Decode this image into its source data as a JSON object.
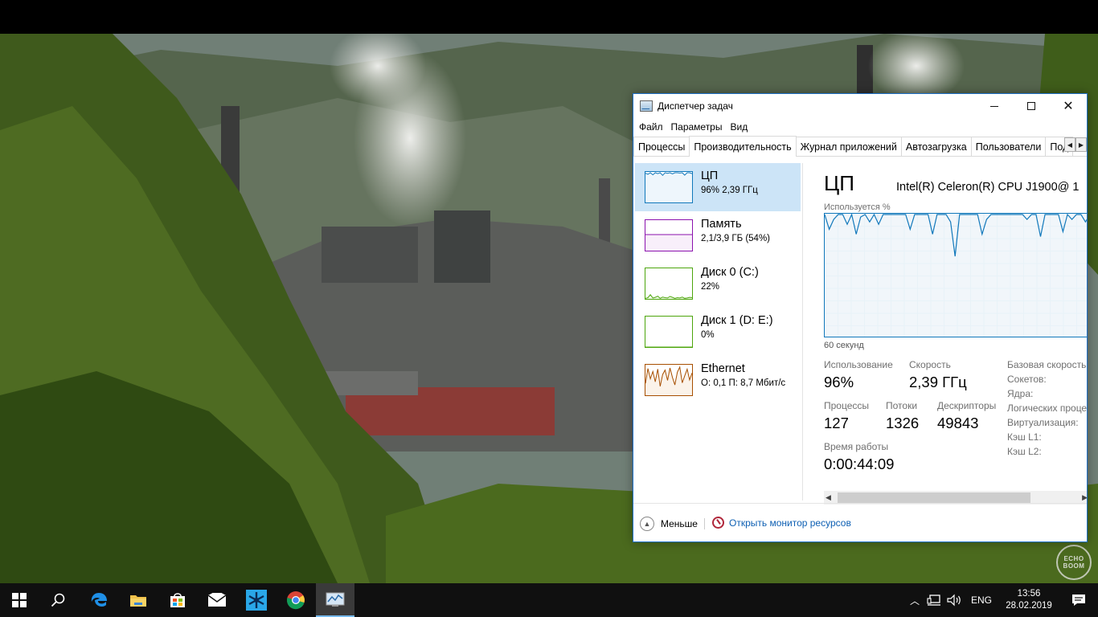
{
  "window": {
    "title": "Диспетчер задач",
    "menu": [
      "Файл",
      "Параметры",
      "Вид"
    ],
    "tabs": [
      "Процессы",
      "Производительность",
      "Журнал приложений",
      "Автозагрузка",
      "Пользователи",
      "Под"
    ],
    "active_tab": "Производительность"
  },
  "resources": [
    {
      "name": "ЦП",
      "detail": "96% 2,39 ГГц",
      "color": "#1178bb",
      "selected": true
    },
    {
      "name": "Память",
      "detail": "2,1/3,9 ГБ (54%)",
      "color": "#8b12ae",
      "selected": false
    },
    {
      "name": "Диск 0 (C:)",
      "detail": "22%",
      "color": "#4da60c",
      "selected": false
    },
    {
      "name": "Диск 1 (D: E:)",
      "detail": "0%",
      "color": "#4da60c",
      "selected": false
    },
    {
      "name": "Ethernet",
      "detail": "О: 0,1 П: 8,7 Мбит/с",
      "color": "#a74f01",
      "selected": false
    }
  ],
  "detail": {
    "title": "ЦП",
    "model": "Intel(R) Celeron(R) CPU J1900@ 1",
    "util_label": "Используется %",
    "time_label": "60 секунд",
    "stats": {
      "usage_label": "Использование",
      "usage_value": "96%",
      "speed_label": "Скорость",
      "speed_value": "2,39 ГГц",
      "processes_label": "Процессы",
      "processes_value": "127",
      "threads_label": "Потоки",
      "threads_value": "1326",
      "handles_label": "Дескрипторы",
      "handles_value": "49843",
      "uptime_label": "Время работы",
      "uptime_value": "0:00:44:09"
    },
    "kv": [
      "Базовая скорость:",
      "Сокетов:",
      "Ядра:",
      "Логических проце",
      "Виртуализация:",
      "Кэш L1:",
      "Кэш L2:"
    ]
  },
  "chart_data": {
    "type": "line",
    "title": "",
    "ylabel": "Используется %",
    "xlabel": "60 секунд",
    "ylim": [
      0,
      100
    ],
    "series": [
      {
        "values": [
          100,
          88,
          96,
          100,
          100,
          92,
          100,
          84,
          98,
          100,
          94,
          100,
          92,
          100,
          100,
          100,
          100,
          100,
          100,
          88,
          100,
          100,
          100,
          100,
          84,
          100,
          100,
          100,
          94,
          66,
          100,
          100,
          100,
          100,
          100,
          84,
          96,
          100,
          100,
          100,
          100,
          100,
          100,
          100,
          100,
          96,
          100,
          100,
          82,
          100,
          100,
          100,
          100,
          86,
          100,
          96,
          100,
          100,
          94,
          100
        ]
      }
    ]
  },
  "thumbs": {
    "cpu": [
      98,
      95,
      100,
      93,
      100,
      97,
      100,
      91,
      100,
      98,
      100,
      96,
      100,
      100,
      99,
      100,
      92,
      100,
      100,
      97
    ],
    "memory": [
      54,
      54,
      54,
      54,
      54,
      54,
      54,
      54,
      54,
      54,
      54,
      54,
      54,
      54,
      54,
      54,
      54,
      54,
      54,
      54
    ],
    "disk0": [
      2,
      4,
      14,
      3,
      5,
      9,
      2,
      6,
      4,
      3,
      8,
      5,
      2,
      4,
      3,
      6,
      2,
      3,
      5,
      4
    ],
    "disk1": [
      0,
      0,
      0,
      0,
      0,
      0,
      0,
      0,
      0,
      0,
      0,
      0,
      0,
      0,
      0,
      0,
      0,
      0,
      0,
      0
    ],
    "ethernet": [
      40,
      90,
      55,
      80,
      45,
      88,
      30,
      70,
      85,
      50,
      92,
      60,
      35,
      78,
      95,
      42,
      65,
      88,
      52,
      75
    ]
  },
  "footer": {
    "fewer": "Меньше",
    "monitor": "Открыть монитор ресурсов"
  },
  "taskbar": {
    "apps": [
      "windows-start",
      "search",
      "edge",
      "file-explorer",
      "store",
      "mail",
      "app-snowflake",
      "chrome",
      "task-manager"
    ],
    "language": "ENG",
    "time": "13:56",
    "date": "28.02.2019"
  },
  "watermark": "ECHO BOOM"
}
